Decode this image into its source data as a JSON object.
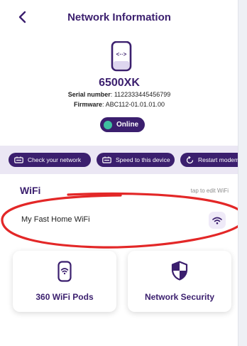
{
  "header": {
    "title": "Network Information"
  },
  "device": {
    "model": "6500XK",
    "serial_label": "Serial number",
    "serial_value": "1122333445456799",
    "firmware_label": "Firmware",
    "firmware_value": "ABC112-01.01.01.00",
    "status": "Online"
  },
  "actions": [
    {
      "label": "Check your network",
      "icon": "router-icon"
    },
    {
      "label": "Speed to this device",
      "icon": "router-icon"
    },
    {
      "label": "Restart modem",
      "icon": "restart-icon"
    }
  ],
  "wifi": {
    "heading": "WiFi",
    "hint": "tap to edit WiFi",
    "network_name": "My Fast Home WiFi",
    "icon": "wifi-icon"
  },
  "cards": [
    {
      "label": "360 WiFi Pods",
      "icon": "wifi-pod-icon"
    },
    {
      "label": "Network Security",
      "icon": "shield-icon"
    }
  ],
  "colors": {
    "brand": "#3b1f6e",
    "accent": "#3fc0a0",
    "action_bar_bg": "#ebe7f4",
    "highlight": "#e32727"
  }
}
